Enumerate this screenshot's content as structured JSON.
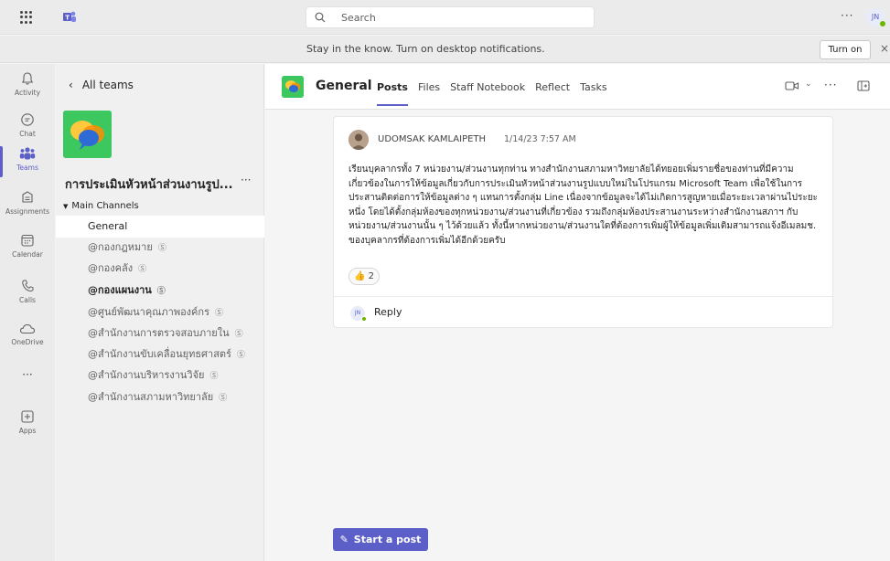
{
  "topbar": {
    "search_placeholder": "Search",
    "more": "···",
    "user_initials": "JN"
  },
  "notification": {
    "message": "Stay in the know. Turn on desktop notifications.",
    "turn_on": "Turn on",
    "close": "×"
  },
  "rail": [
    {
      "label": "Activity",
      "icon": "bell-icon"
    },
    {
      "label": "Chat",
      "icon": "chat-icon"
    },
    {
      "label": "Teams",
      "icon": "teams-icon"
    },
    {
      "label": "Assignments",
      "icon": "assignments-icon"
    },
    {
      "label": "Calendar",
      "icon": "calendar-icon"
    },
    {
      "label": "Calls",
      "icon": "phone-icon"
    },
    {
      "label": "OneDrive",
      "icon": "cloud-icon"
    },
    {
      "label": "···",
      "icon": "more-icon"
    },
    {
      "label": "Apps",
      "icon": "apps-icon"
    }
  ],
  "sidebar": {
    "back_label": "All teams",
    "team_name": "การประเมินหัวหน้าส่วนงานรูป...",
    "team_more": "···",
    "section_label": "Main Channels",
    "channels": [
      "General",
      "@กองกฎหมาย",
      "@กองคลัง",
      "@กองแผนงาน",
      "@ศูนย์พัฒนาคุณภาพองค์กร",
      "@สำนักงานการตรวจสอบภายใน",
      "@สำนักงานขับเคลื่อนยุทธศาสตร์",
      "@สำนักงานบริหารงานวิจัย",
      "@สำนักงานสภามหาวิทยาลัย"
    ]
  },
  "main": {
    "channel_title": "General",
    "tabs": [
      "Posts",
      "Files",
      "Staff Notebook",
      "Reflect",
      "Tasks"
    ],
    "post": {
      "author": "UDOMSAK KAMLAIPETH",
      "time": "1/14/23 7:57 AM",
      "body": "เรียนบุคลากรทั้ง 7 หน่วยงาน/ส่วนงานทุกท่าน ทางสำนักงานสภามหาวิทยาลัยได้ทยอยเพิ่มรายชื่อของท่านที่มีความเกี่ยวข้องในการให้ข้อมูลเกี่ยวกับการประเมินหัวหน้าส่วนงานรูปแบบใหม่ในโปรแกรม Microsoft Team เพื่อใช้ในการประสานติดต่อการให้ข้อมูลต่าง ๆ แทนการตั้งกลุ่ม Line เนื่องจากข้อมูลจะได้ไม่เกิดการสูญหายเมื่อระยะเวลาผ่านไประยะหนึ่ง โดยได้ตั้งกลุ่มห้องของทุกหน่วยงาน/ส่วนงานที่เกี่ยวข้อง รวมถึงกลุ่มห้องประสานงานระหว่างสำนักงานสภาฯ กับหน่วยงาน/ส่วนงานนั้น ๆ ไว้ด้วยแล้ว ทั้งนี้หากหน่วยงาน/ส่วนงานใดที่ต้องการเพิ่มผู้ให้ข้อมูลเพิ่มเติมสามารถแจ้งอีเมลมช. ของบุคลากรที่ต้องการเพิ่มได้อีกด้วยครับ",
      "reaction_emoji": "👍",
      "reaction_count": "2",
      "reply_initials": "JN",
      "reply_label": "Reply"
    },
    "start_post_label": "Start a post",
    "accent_color": "#5b5fc7"
  }
}
